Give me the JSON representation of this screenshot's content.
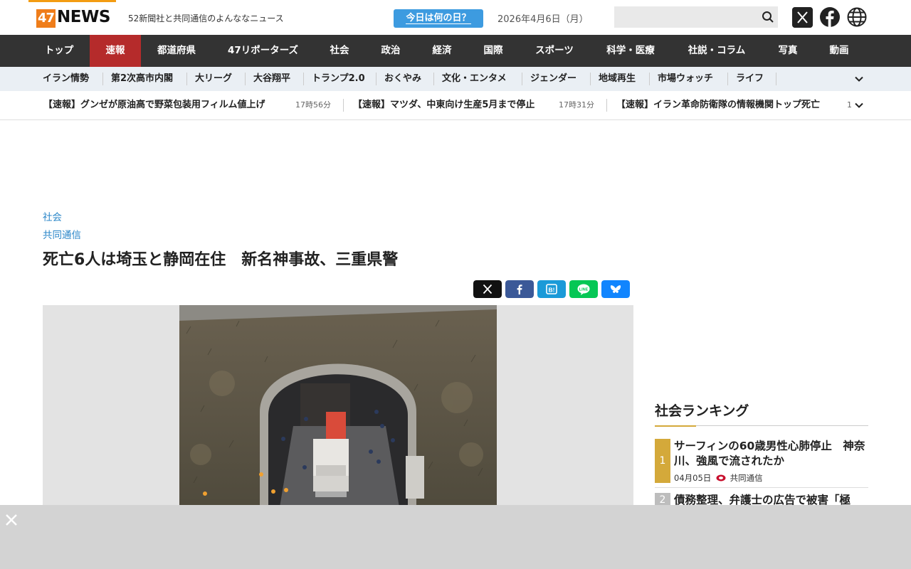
{
  "header": {
    "logo_num": "47",
    "logo_word": "NEWS",
    "tagline": "52新聞社と共同通信のよんななニュース",
    "today_button": "今日は何の日？",
    "date": "2026年4月6日（月）",
    "search_placeholder": ""
  },
  "mainnav": {
    "items": [
      "トップ",
      "速報",
      "都道府県",
      "47リポーターズ",
      "社会",
      "政治",
      "経済",
      "国際",
      "スポーツ",
      "科学・医療",
      "社説・コラム",
      "写真",
      "動画"
    ],
    "active_index": 1
  },
  "subnav": {
    "items": [
      "イラン情勢",
      "第2次高市内閣",
      "大リーグ",
      "大谷翔平",
      "トランプ2.0",
      "おくやみ",
      "文化・エンタメ",
      "ジェンダー",
      "地域再生",
      "市場ウォッチ",
      "ライフ"
    ]
  },
  "ticker": {
    "items": [
      {
        "text": "【速報】グンゼが原油高で野菜包装用フィルム値上げ",
        "time": "17時56分"
      },
      {
        "text": "【速報】マツダ、中東向け生産5月まで停止",
        "time": "17時31分"
      },
      {
        "text": "【速報】イラン革命防衛隊の情報機関トップ死亡",
        "time": "1"
      }
    ]
  },
  "article": {
    "category": "社会",
    "source": "共同通信",
    "title": "死亡6人は埼玉と静岡在住　新名神事故、三重県警"
  },
  "share_buttons": [
    {
      "name": "x-share-button",
      "color": "#111111"
    },
    {
      "name": "facebook-share-button",
      "color": "#3b5998"
    },
    {
      "name": "hatena-share-button",
      "color": "#1a9ad8"
    },
    {
      "name": "line-share-button",
      "color": "#06c755"
    },
    {
      "name": "bluesky-share-button",
      "color": "#1185fe"
    }
  ],
  "ranking": {
    "title": "社会ランキング",
    "items": [
      {
        "rank": "1",
        "text": "サーフィンの60歳男性心肺停止　神奈川、強風で流されたか",
        "date": "04月05日",
        "source": "共同通信"
      },
      {
        "rank": "2",
        "text": "債務整理、弁護士の広告で被害「極"
      }
    ]
  },
  "colors": {
    "accent_blue": "#3d9be0",
    "nav_bg": "#333333",
    "nav_active": "#b52b2b",
    "rank_gold": "#d4a93a",
    "logo_orange": "#ef7d1a"
  }
}
